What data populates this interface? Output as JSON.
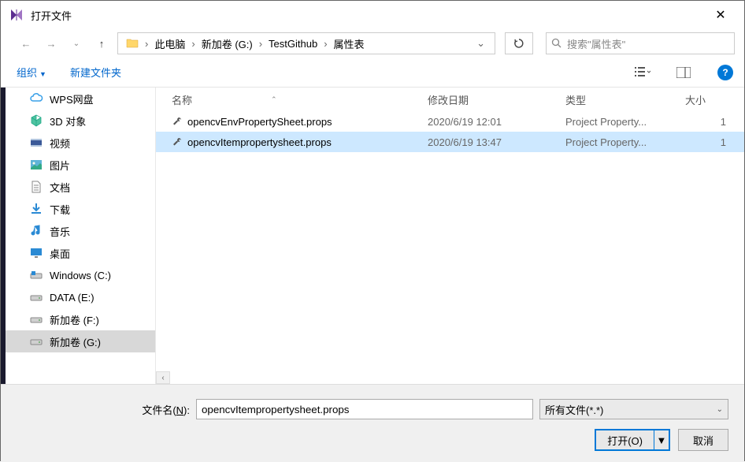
{
  "window": {
    "title": "打开文件"
  },
  "breadcrumb": {
    "items": [
      "此电脑",
      "新加卷 (G:)",
      "TestGithub",
      "属性表"
    ]
  },
  "search": {
    "placeholder": "搜索\"属性表\""
  },
  "toolbar": {
    "organize": "组织",
    "new_folder": "新建文件夹"
  },
  "tree": {
    "items": [
      {
        "label": "WPS网盘",
        "icon": "cloud"
      },
      {
        "label": "3D 对象",
        "icon": "3d"
      },
      {
        "label": "视频",
        "icon": "video"
      },
      {
        "label": "图片",
        "icon": "picture"
      },
      {
        "label": "文档",
        "icon": "document"
      },
      {
        "label": "下载",
        "icon": "download"
      },
      {
        "label": "音乐",
        "icon": "music"
      },
      {
        "label": "桌面",
        "icon": "desktop"
      },
      {
        "label": "Windows (C:)",
        "icon": "drive-win"
      },
      {
        "label": "DATA (E:)",
        "icon": "drive"
      },
      {
        "label": "新加卷 (F:)",
        "icon": "drive"
      },
      {
        "label": "新加卷 (G:)",
        "icon": "drive"
      }
    ],
    "selected_index": 11
  },
  "columns": {
    "name": "名称",
    "date": "修改日期",
    "type": "类型",
    "size": "大小"
  },
  "files": [
    {
      "name": "opencvEnvPropertySheet.props",
      "date": "2020/6/19 12:01",
      "type": "Project Property...",
      "size": "1",
      "selected": false
    },
    {
      "name": "opencvItempropertysheet.props",
      "date": "2020/6/19 13:47",
      "type": "Project Property...",
      "size": "1",
      "selected": true
    }
  ],
  "footer": {
    "filename_label_prefix": "文件名(",
    "filename_label_key": "N",
    "filename_label_suffix": "):",
    "filename_value": "opencvItempropertysheet.props",
    "filetype": "所有文件(*.*)",
    "open_label": "打开(O)",
    "cancel_label": "取消"
  }
}
